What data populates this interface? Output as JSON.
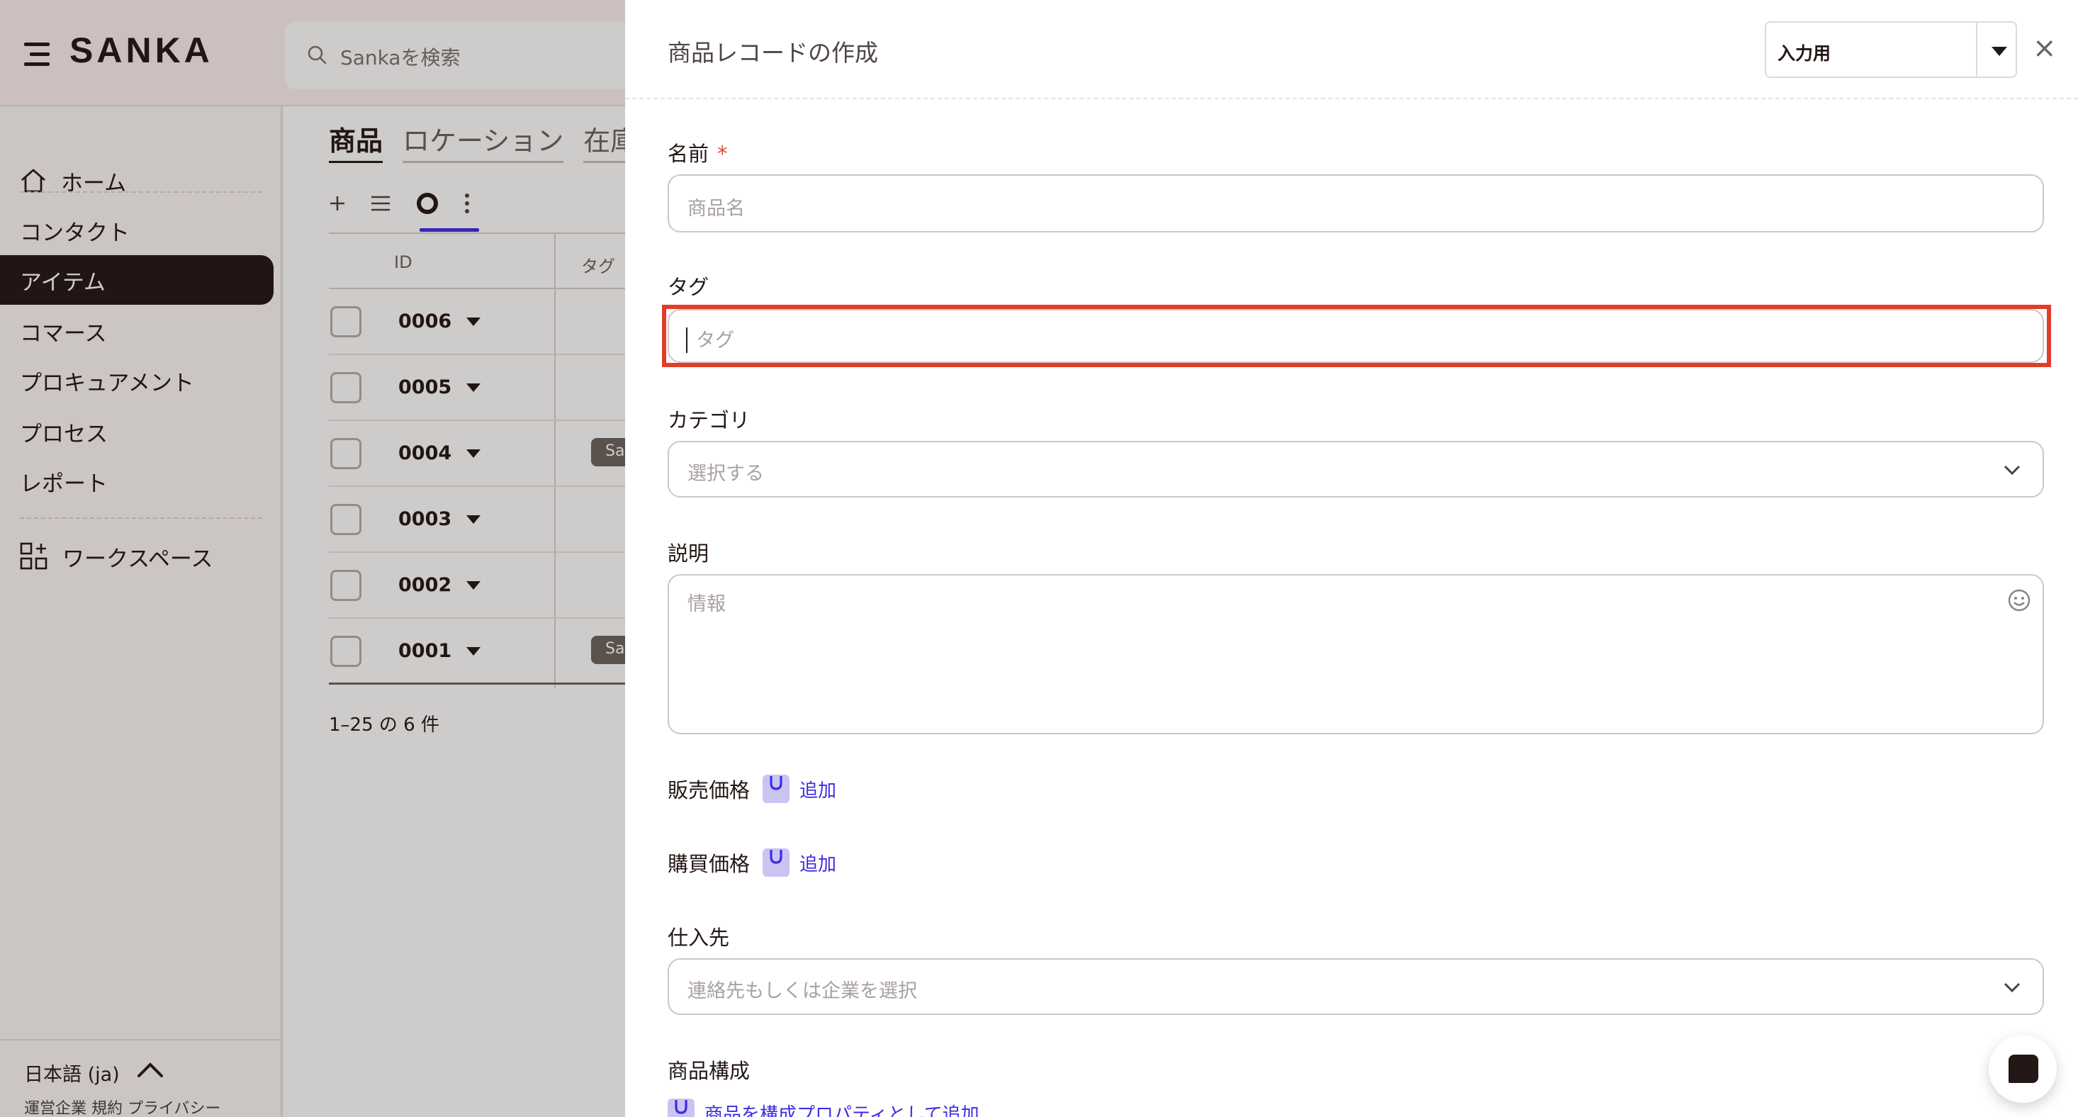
{
  "app": {
    "brand": "SANKA"
  },
  "search": {
    "placeholder": "Sankaを検索"
  },
  "sidebar": {
    "items": [
      {
        "label": "ホーム"
      },
      {
        "label": "コンタクト"
      },
      {
        "label": "アイテム"
      },
      {
        "label": "コマース"
      },
      {
        "label": "プロキュアメント"
      },
      {
        "label": "プロセス"
      },
      {
        "label": "レポート"
      },
      {
        "label": "ワークスペース"
      }
    ],
    "language": "日本語 (ja)",
    "footer_links": "運営企業 規約 プライバシー"
  },
  "main": {
    "tabs": [
      {
        "label": "商品"
      },
      {
        "label": "ロケーション"
      },
      {
        "label": "在庫"
      }
    ],
    "table": {
      "headers": {
        "id": "ID",
        "tag": "タグ"
      },
      "rows": [
        {
          "id": "0006",
          "tag": ""
        },
        {
          "id": "0005",
          "tag": ""
        },
        {
          "id": "0004",
          "tag": "San"
        },
        {
          "id": "0003",
          "tag": ""
        },
        {
          "id": "0002",
          "tag": ""
        },
        {
          "id": "0001",
          "tag": "San"
        }
      ]
    },
    "pagination": "1–25 の 6 件"
  },
  "drawer": {
    "title": "商品レコードの作成",
    "mode": "入力用",
    "close_symbol": "×",
    "fields": {
      "name": {
        "label": "名前",
        "required_mark": "*",
        "placeholder": "商品名"
      },
      "tags": {
        "label": "タグ",
        "placeholder": "タグ"
      },
      "category": {
        "label": "カテゴリ",
        "placeholder": "選択する"
      },
      "description": {
        "label": "説明",
        "placeholder": "情報"
      },
      "sale_price": {
        "label": "販売価格",
        "add_label": "追加"
      },
      "purchase_price": {
        "label": "購買価格",
        "add_label": "追加"
      },
      "supplier": {
        "label": "仕入先",
        "placeholder": "連絡先もしくは企業を選択"
      },
      "composition": {
        "label": "商品構成",
        "add_label": "商品を構成プロパティとして追加"
      }
    }
  },
  "colors": {
    "accent": "#3d2be3",
    "highlight": "#e23d28",
    "active_nav": "#231815",
    "required": "#e34a2c"
  }
}
